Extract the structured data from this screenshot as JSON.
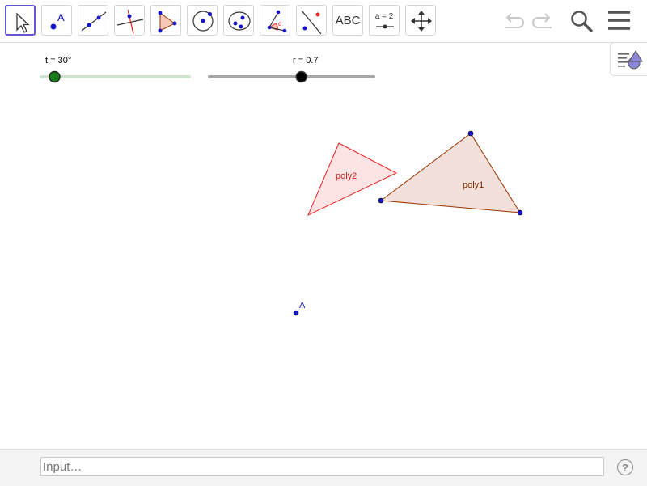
{
  "toolbar": {
    "tools": [
      {
        "name": "move-tool",
        "selected": true
      },
      {
        "name": "point-tool"
      },
      {
        "name": "line-tool"
      },
      {
        "name": "perpendicular-line-tool"
      },
      {
        "name": "polygon-tool"
      },
      {
        "name": "circle-tool"
      },
      {
        "name": "conic-tool"
      },
      {
        "name": "angle-tool"
      },
      {
        "name": "reflect-tool"
      },
      {
        "name": "text-tool",
        "label": "ABC"
      },
      {
        "name": "slider-tool",
        "label": "a = 2"
      },
      {
        "name": "move-graphics-view-tool"
      }
    ],
    "right_icons": [
      "undo-icon",
      "redo-icon",
      "search-icon",
      "menu-icon"
    ]
  },
  "side_panel": {
    "icon": "algebra-view-icon"
  },
  "sliders": {
    "t": {
      "label": "t = 30°",
      "value": 30,
      "fill_fraction": 0.09,
      "color": "#1b7e1b"
    },
    "r": {
      "label": "r = 0.7",
      "value": 0.7,
      "fill_fraction": 0.56,
      "color": "#000000"
    }
  },
  "objects": {
    "poly1": {
      "label": "poly1",
      "fill": "#f2e1da",
      "stroke": "#993300"
    },
    "poly2": {
      "label": "poly2",
      "fill": "#fde4e4",
      "stroke": "#e32222"
    },
    "point_a": {
      "label": "A",
      "color": "#1515cc"
    }
  },
  "input_bar": {
    "placeholder": "Input…",
    "help_label": "?"
  },
  "colors": {
    "selection": "#6557d2",
    "point": "#1515cc"
  }
}
